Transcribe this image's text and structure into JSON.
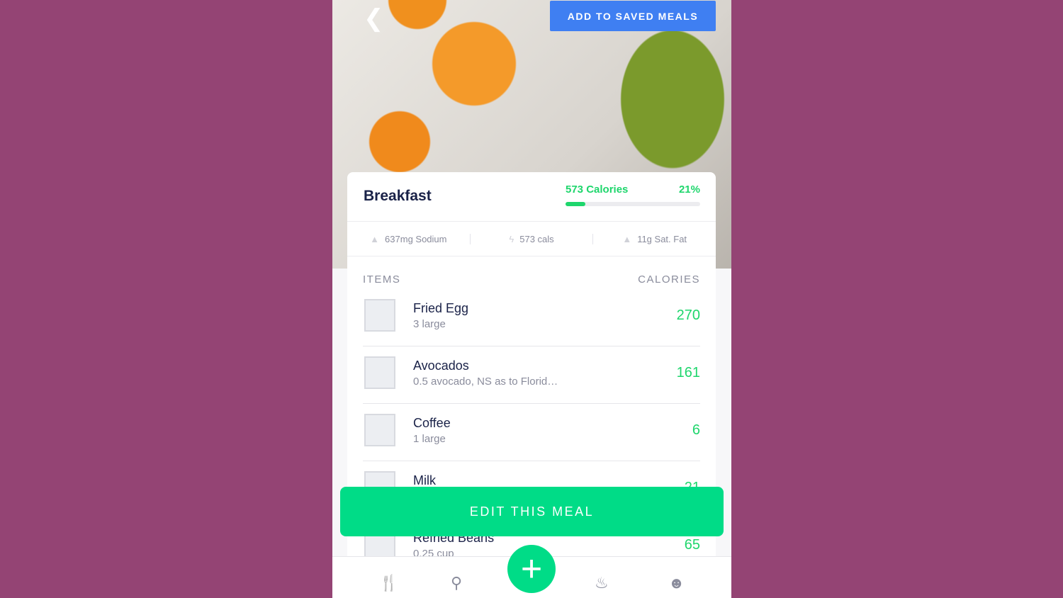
{
  "header": {
    "back_icon": "chevron-left-icon",
    "save_label": "ADD TO SAVED MEALS"
  },
  "meal": {
    "title": "Breakfast",
    "calories": "573 Calories",
    "percent": "21%",
    "progress_percent": 21
  },
  "stats": [
    {
      "icon": "pyramid-icon",
      "label": "637mg Sodium"
    },
    {
      "icon": "bolt-icon",
      "label": "573 cals"
    },
    {
      "icon": "pyramid-icon",
      "label": "11g Sat. Fat"
    }
  ],
  "columns": {
    "items": "ITEMS",
    "calories": "CALORIES"
  },
  "items": [
    {
      "name": "Fried Egg",
      "serving": "3 large",
      "calories": "270"
    },
    {
      "name": "Avocados",
      "serving": "0.5 avocado, NS as to Florid…",
      "calories": "161"
    },
    {
      "name": "Coffee",
      "serving": "1 large",
      "calories": "6"
    },
    {
      "name": "Milk",
      "serving": "",
      "calories": "21"
    },
    {
      "name": "Refried Beans",
      "serving": "0.25 cup",
      "calories": "65"
    }
  ],
  "edit_label": "EDIT THIS MEAL",
  "nav": [
    "fork-knife-icon",
    "search-icon",
    "plus-icon",
    "chef-hat-icon",
    "user-icon"
  ],
  "colors": {
    "accent": "#00dc87",
    "blue": "#3f7ff2",
    "background": "#944474"
  }
}
